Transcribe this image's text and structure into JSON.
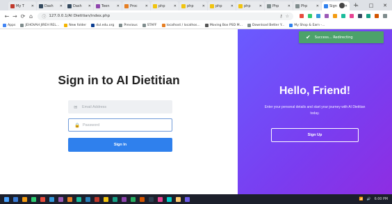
{
  "browser": {
    "tabs": [
      {
        "label": "My T",
        "color": "#c0392b",
        "active": false
      },
      {
        "label": "Dash",
        "color": "#34495e",
        "active": false
      },
      {
        "label": "Dash",
        "color": "#34495e",
        "active": false
      },
      {
        "label": "Teen",
        "color": "#8e44ad",
        "active": false
      },
      {
        "label": "Proc",
        "color": "#e67e22",
        "active": false
      },
      {
        "label": "php",
        "color": "#f1c40f",
        "active": false
      },
      {
        "label": "php",
        "color": "#f1c40f",
        "active": false
      },
      {
        "label": "php",
        "color": "#f1c40f",
        "active": false
      },
      {
        "label": "php",
        "color": "#f1c40f",
        "active": false
      },
      {
        "label": "Php",
        "color": "#7f8c8d",
        "active": false
      },
      {
        "label": "Php",
        "color": "#7f8c8d",
        "active": false
      },
      {
        "label": "Sign",
        "color": "#2f80ed",
        "active": true
      }
    ],
    "newtab_symbol": "+",
    "window_controls": [
      "–",
      "□",
      "✕"
    ],
    "back": "←",
    "forward": "→",
    "reload": "⟳",
    "home": "⌂",
    "url": "127.0.0.1/AI Dietitian/index.php",
    "bookmarks": [
      {
        "label": "Apps",
        "color": "#4285f4"
      },
      {
        "label": "JEHOVAH JIREH REL...",
        "color": "#7f8c8d"
      },
      {
        "label": "New folder",
        "color": "#f4b400"
      },
      {
        "label": "dul.edu.org",
        "color": "#0b3d91"
      },
      {
        "label": "Previous",
        "color": "#7f8c8d"
      },
      {
        "label": "STAFF",
        "color": "#7f8c8d"
      },
      {
        "label": "localhost / localhos...",
        "color": "#e67e22"
      },
      {
        "label": "Moving Box PSD M...",
        "color": "#555555"
      },
      {
        "label": "Download Better Y...",
        "color": "#7f8c8d"
      },
      {
        "label": "My Shop & Earn -...",
        "color": "#2f80ed"
      }
    ]
  },
  "signin": {
    "title": "Sign in to AI Dietitian",
    "email_placeholder": "Email Address",
    "password_placeholder": "Password",
    "button": "Sign In"
  },
  "welcome": {
    "title": "Hello, Friend!",
    "text": "Enter your personal details and start your journey with AI Dietitian today.",
    "button": "Sign Up"
  },
  "toast": {
    "message": "Success... Redirecting",
    "color": "#4ca26b"
  },
  "taskbar": {
    "icons": [
      "#3a7bd5",
      "#f39c12",
      "#2ecc71",
      "#e74c3c",
      "#3498db",
      "#9b59b6",
      "#e67e22",
      "#1abc9c",
      "#2980b9",
      "#c0392b",
      "#f1c40f",
      "#16a085",
      "#8e44ad",
      "#27ae60",
      "#d35400",
      "#2c3e50",
      "#e84393",
      "#00cec9",
      "#fdcb6e",
      "#6c5ce7"
    ],
    "time": "6:00 PM"
  },
  "colors": {
    "accent": "#2f80ed",
    "gradient_start": "#6a5bff",
    "gradient_end": "#8e2de2"
  }
}
